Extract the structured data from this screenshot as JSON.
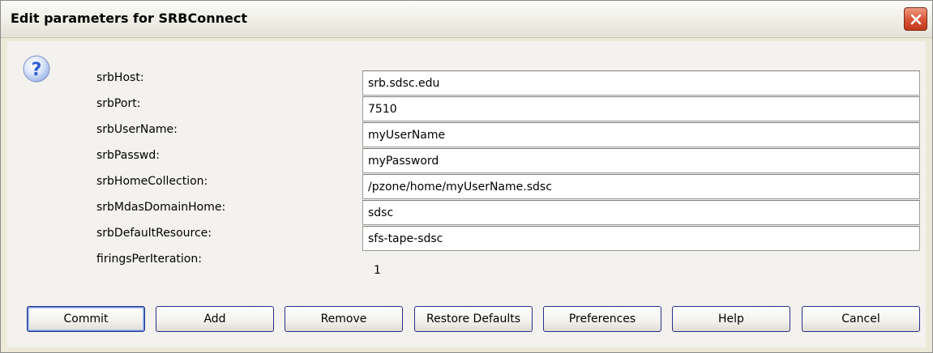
{
  "dialog": {
    "title": "Edit parameters for SRBConnect",
    "close_icon": "close-icon",
    "help_icon": "question-mark-icon"
  },
  "parameters": [
    {
      "label": "srbHost:",
      "value": "srb.sdsc.edu"
    },
    {
      "label": "srbPort:",
      "value": "7510"
    },
    {
      "label": "srbUserName:",
      "value": "myUserName"
    },
    {
      "label": "srbPasswd:",
      "value": "myPassword"
    },
    {
      "label": "srbHomeCollection:",
      "value": "/pzone/home/myUserName.sdsc"
    },
    {
      "label": "srbMdasDomainHome:",
      "value": "sdsc"
    },
    {
      "label": "srbDefaultResource:",
      "value": "sfs-tape-sdsc"
    }
  ],
  "firings": {
    "label": "firingsPerIteration:",
    "value": "1"
  },
  "buttons": {
    "commit": "Commit",
    "add": "Add",
    "remove": "Remove",
    "restore_defaults": "Restore Defaults",
    "preferences": "Preferences",
    "help": "Help",
    "cancel": "Cancel"
  },
  "colors": {
    "close_button": "#d9573a",
    "button_border": "#27308a",
    "help_icon_blue": "#2f5fd0"
  }
}
